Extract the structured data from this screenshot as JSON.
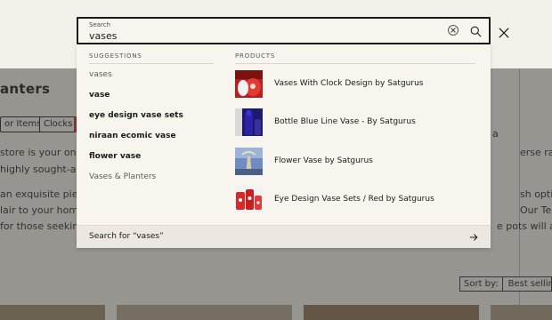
{
  "search": {
    "label": "Search",
    "value": "vases"
  },
  "suggestions": {
    "heading": "SUGGESTIONS",
    "items": [
      {
        "label": "vases",
        "style": "light"
      },
      {
        "label": "vase",
        "style": "bold"
      },
      {
        "label": "eye design vase sets",
        "style": "bold"
      },
      {
        "label": "niraan ecomic vase",
        "style": "bold"
      },
      {
        "label": "flower vase",
        "style": "bold"
      },
      {
        "label": "Vases & Planters",
        "style": "light"
      }
    ]
  },
  "products": {
    "heading": "PRODUCTS",
    "items": [
      {
        "name": "Vases With Clock Design by Satgurus",
        "thumb": "red-vase-clock"
      },
      {
        "name": "Bottle Blue Line Vase - By Satgurus",
        "thumb": "blue-bottle-vase"
      },
      {
        "name": "Flower Vase by Satgurus",
        "thumb": "flower-vase"
      },
      {
        "name": "Eye Design Vase Sets / Red by Satgurus",
        "thumb": "red-eye-vase-set"
      }
    ]
  },
  "search_for": {
    "label": "Search for “vases”"
  },
  "background": {
    "title": "anters",
    "chips": [
      "or Items",
      "Clocks"
    ],
    "lines_left": [
      "store is your one",
      "highly sought-afte",
      "an exquisite piece",
      "lair to your home",
      "for those seekin"
    ],
    "lines_right": [
      "erse ra",
      "sh optio",
      "Our Terr",
      "e pots will add"
    ],
    "right_fragment": "a",
    "sort_label": "Sort by:",
    "sort_value": "Best selling"
  },
  "colors": {
    "page_bg": "#f3f0ea",
    "dropdown_bg": "#f8f5ef",
    "footer_bg": "#ece8e1",
    "overlay": "rgba(60,58,54,0.5)"
  }
}
